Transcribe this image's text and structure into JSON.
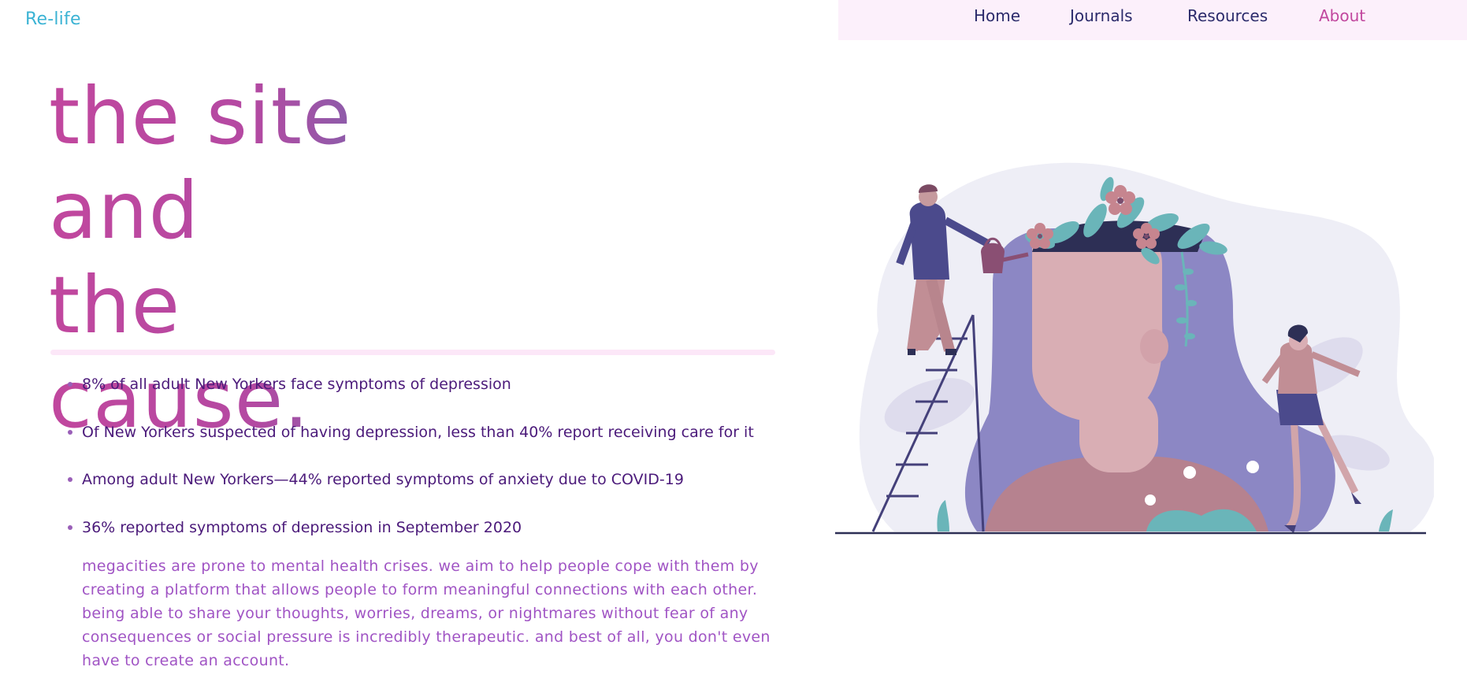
{
  "brand": {
    "name": "Re-life"
  },
  "nav": {
    "items": [
      {
        "label": "Home"
      },
      {
        "label": "Journals"
      },
      {
        "label": "Resources"
      },
      {
        "label": "About"
      }
    ],
    "active": "About"
  },
  "hero": {
    "lines": [
      "the site",
      "and",
      "the cause."
    ]
  },
  "stats": [
    "8% of all adult New Yorkers face symptoms of depression",
    "Of New Yorkers suspected of having depression, less than 40% report receiving care for it",
    "Among adult New Yorkers—44% reported symptoms of anxiety due to COVID-19",
    "36% reported symptoms of depression in September 2020"
  ],
  "about_text": "megacities are prone to mental health crises. we aim to help people cope with them by creating a platform that allows people to form meaningful connections with each other. being able to share your thoughts, worries, dreams, or nightmares without fear of any consequences or social pressure is incredibly therapeutic. and best of all, you don't even have to create an account.",
  "colors": {
    "brand": "#3bb3d4",
    "nav_bg": "#fcf0fb",
    "nav_text": "#2b2b6b",
    "nav_active": "#c1479e",
    "hero_gradient_start": "#c1479e",
    "hero_gradient_end": "#6f6bb0",
    "stats_text": "#4b1a7a",
    "about_text": "#a054c4"
  },
  "icons": {
    "illustration": "mental-health-garden-illustration"
  }
}
